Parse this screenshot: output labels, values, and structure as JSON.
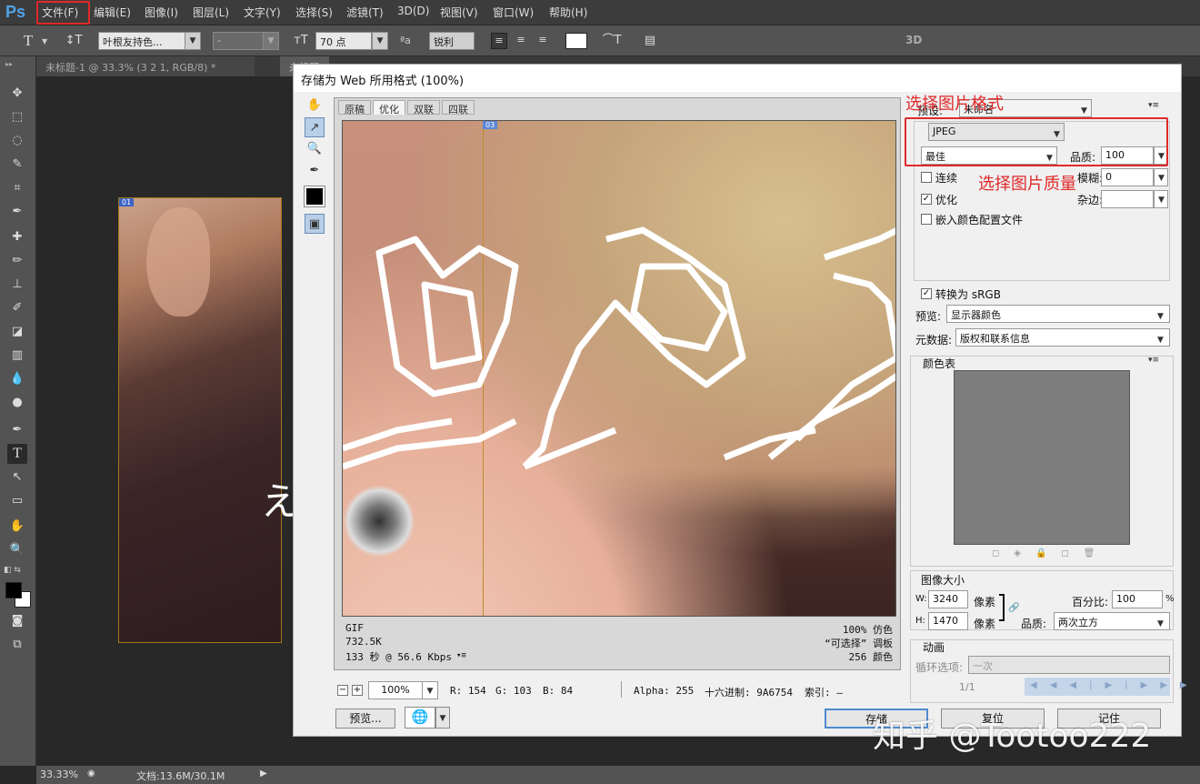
{
  "menubar": {
    "logo": "Ps",
    "items": [
      "文件(F)",
      "编辑(E)",
      "图像(I)",
      "图层(L)",
      "文字(Y)",
      "选择(S)",
      "滤镜(T)",
      "3D(D)",
      "视图(V)",
      "窗口(W)",
      "帮助(H)"
    ]
  },
  "options": {
    "font_family": "叶根友持色...",
    "font_style": "-",
    "font_size": "70 点",
    "antialias_icon": "ªa",
    "antialias": "锐利",
    "threed": "3D"
  },
  "tabs": [
    "未标题-1 @ 33.3% (3  2  1, RGB/8) *",
    "未标题"
  ],
  "status": {
    "zoom": "33.33%",
    "doc": "文档:13.6M/30.1M"
  },
  "dialog": {
    "title": "存储为 Web 所用格式 (100%)",
    "view_tabs": [
      "原稿",
      "优化",
      "双联",
      "四联"
    ],
    "slice_badge": "03",
    "canvas_slice_badge": "01",
    "info_left": [
      "GIF",
      "732.5K",
      "133 秒 @ 56.6 Kbps"
    ],
    "info_right": [
      "100% 仿色",
      "“可选择” 调板",
      "256 颜色"
    ],
    "zoom": "100%",
    "readout": {
      "r": "R: 154",
      "g": "G: 103",
      "b": "B: 84",
      "alpha": "Alpha: 255",
      "hex": "十六进制: 9A6754",
      "index": "索引: —"
    },
    "preview_btn": "预览...",
    "save_btn": "存储",
    "reset_btn": "复位",
    "remember_btn": "记住",
    "preset_label": "预设:",
    "preset_value": "未命名",
    "format": "JPEG",
    "quality_preset": "最佳",
    "quality_label": "品质:",
    "quality_value": "100",
    "progressive": "连续",
    "blur_label": "模糊:",
    "blur_value": "0",
    "optimized": "优化",
    "matte_label": "杂边:",
    "embed_profile": "嵌入颜色配置文件",
    "convert_srgb": "转换为 sRGB",
    "preview_label": "预览:",
    "preview_value": "显示器颜色",
    "metadata_label": "元数据:",
    "metadata_value": "版权和联系信息",
    "color_table": "颜色表",
    "image_size": "图像大小",
    "w_label": "W:",
    "w_value": "3240",
    "h_label": "H:",
    "h_value": "1470",
    "unit": "像素",
    "percent_label": "百分比:",
    "percent_value": "100",
    "percent_sign": "%",
    "resample_label": "品质:",
    "resample_value": "两次立方",
    "animation": "动画",
    "loop_label": "循环选项:",
    "loop_value": "一次",
    "frame": "1/1",
    "menu_glyph": "▾≡"
  },
  "annotations": {
    "format_note": "选择图片格式",
    "quality_note": "选择图片质量"
  },
  "watermark": "知乎 @Tootoo222",
  "colors": {
    "accent_red": "#e0292a",
    "ps_blue": "#4fa3e8"
  }
}
